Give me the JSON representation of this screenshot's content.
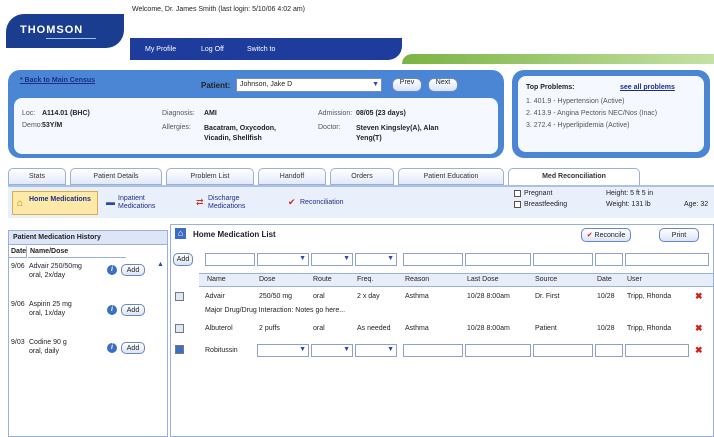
{
  "header": {
    "logo": "THOMSON",
    "welcome": "Welcome, Dr. James Smith (last login: 5/10/06 4:02 am)",
    "nav": [
      "My Profile",
      "Log Off",
      "Switch to"
    ]
  },
  "patient": {
    "back_link": "* Back to Main Census",
    "label": "Patient:",
    "selected": "Johnson, Jake D",
    "prev": "Prev",
    "next": "Next",
    "loc_label": "Loc:",
    "loc": "A114.01 (BHC)",
    "demo_label": "Demo:",
    "demo": "53Y/M",
    "diagnosis_label": "Diagnosis:",
    "diagnosis": "AMI",
    "allergies_label": "Allergies:",
    "allergies": "Bacatram, Oxycodon, Vicadin, Shellfish",
    "admission_label": "Admission:",
    "admission": "08/05 (23 days)",
    "doctor_label": "Doctor:",
    "doctor": "Steven Kingsley(A), Alan Yeng(T)"
  },
  "problems": {
    "title": "Top Problems:",
    "see_all": "see all problems",
    "items": [
      "1. 401.9 - Hypertension (Active)",
      "2. 413.9 - Angina Pectoris NEC/Nos (Inac)",
      "3. 272.4 - Hyperlipidemia (Active)"
    ]
  },
  "tabs": [
    "Stats",
    "Patient Details",
    "Problem List",
    "Handoff",
    "Orders",
    "Patient Education",
    "Med Reconciliation"
  ],
  "toolbar": {
    "home": "Home Medications",
    "inpatient": "Inpatient Medications",
    "discharge": "Discharge Medications",
    "reconciliation": "Reconciliation",
    "pregnant": "Pregnant",
    "breastfeeding": "Breastfeeding",
    "height": "Height: 5 ft 5 in",
    "weight": "Weight: 131 lb",
    "age": "Age: 32"
  },
  "history": {
    "title": "Patient Medication History",
    "col_date": "Date",
    "col_name": "Name/Dose",
    "add": "Add",
    "rows": [
      {
        "date": "9/06",
        "name": "Advair 250/50mg",
        "detail": "oral, 2x/day"
      },
      {
        "date": "9/06",
        "name": "Aspirin 25 mg",
        "detail": "oral, 1x/day"
      },
      {
        "date": "9/03",
        "name": "Codine 90 g",
        "detail": "oral, daily"
      }
    ]
  },
  "main": {
    "title": "Home Medication List",
    "reconcile": "Reconcile",
    "print": "Print",
    "add": "Add",
    "columns": [
      "Name",
      "Dose",
      "Route",
      "Freq.",
      "Reason",
      "Last Dose",
      "Source",
      "Date",
      "User"
    ],
    "rows": [
      {
        "name": "Advair",
        "dose": "250/50 mg",
        "route": "oral",
        "freq": "2 x day",
        "reason": "Asthma",
        "last": "10/28 8:00am",
        "source": "Dr. First",
        "date": "10/28",
        "user": "Tripp, Rhonda"
      },
      {
        "name": "Albuterol",
        "dose": "2 puffs",
        "route": "oral",
        "freq": "As needed",
        "reason": "Asthma",
        "last": "10/28 8:00am",
        "source": "Patient",
        "date": "10/28",
        "user": "Tripp, Rhonda"
      },
      {
        "name": "Robitussin"
      }
    ],
    "interaction": "Major Drug/Drug Interaction: Notes go here..."
  },
  "colors": {
    "navy": "#1d3c9c",
    "panel_blue": "#4a86d4",
    "green": "#7cb342",
    "alert_red": "#d02020"
  }
}
